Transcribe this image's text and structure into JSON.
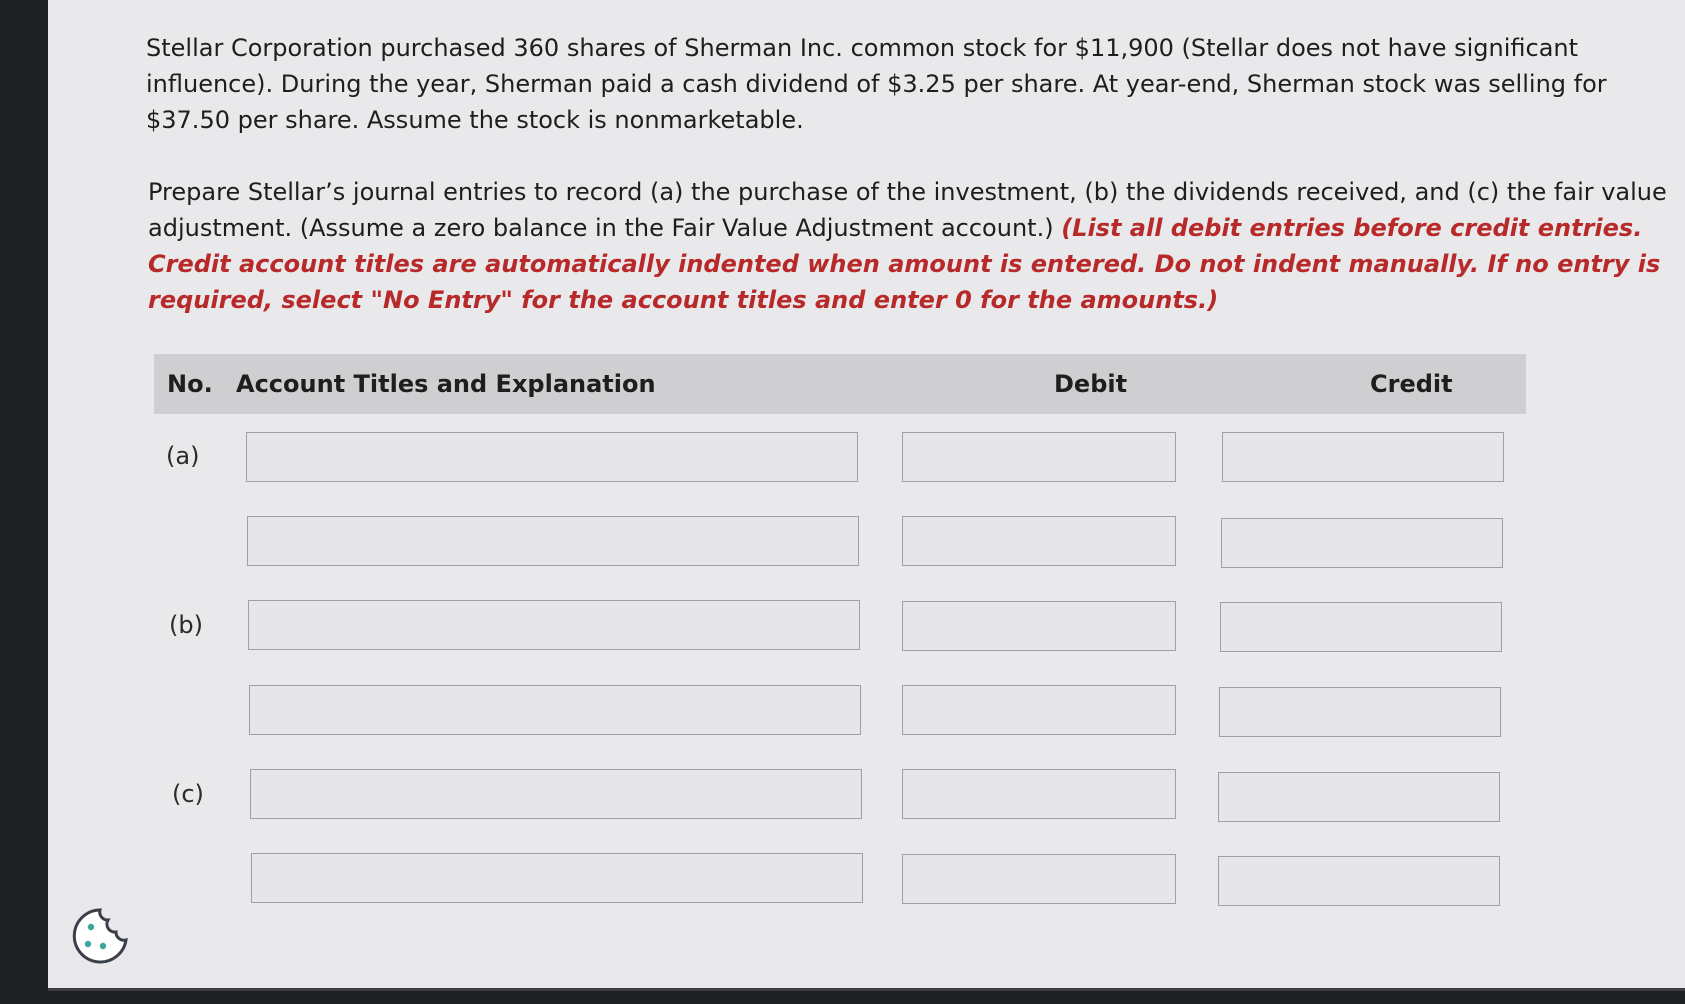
{
  "problem": {
    "text": "Stellar Corporation purchased 360 shares of Sherman Inc. common stock for $11,900 (Stellar does not have significant influence). During the year, Sherman paid a cash dividend of $3.25 per share. At year-end, Sherman stock was selling for $37.50 per share. Assume the stock is nonmarketable."
  },
  "instructions": {
    "main": "Prepare Stellar’s journal entries to record (a) the purchase of the investment, (b) the dividends received, and (c) the fair value adjustment. (Assume a zero balance in the Fair Value Adjustment account.) ",
    "note": "(List all debit entries before credit entries. Credit account titles are automatically indented when amount is entered. Do not indent manually. If no entry is required, select \"No Entry\" for the account titles and enter 0 for the amounts.)"
  },
  "table": {
    "headers": {
      "no": "No.",
      "account": "Account Titles and Explanation",
      "debit": "Debit",
      "credit": "Credit"
    },
    "rows": [
      {
        "label": "(a)",
        "account": "",
        "debit": "",
        "credit": ""
      },
      {
        "label": "",
        "account": "",
        "debit": "",
        "credit": ""
      },
      {
        "label": "(b)",
        "account": "",
        "debit": "",
        "credit": ""
      },
      {
        "label": "",
        "account": "",
        "debit": "",
        "credit": ""
      },
      {
        "label": "(c)",
        "account": "",
        "debit": "",
        "credit": ""
      },
      {
        "label": "",
        "account": "",
        "debit": "",
        "credit": ""
      }
    ]
  },
  "icons": {
    "cookie": "cookie-icon"
  },
  "colors": {
    "note_red": "#b82a2a",
    "header_bg": "#cfcfd1"
  }
}
